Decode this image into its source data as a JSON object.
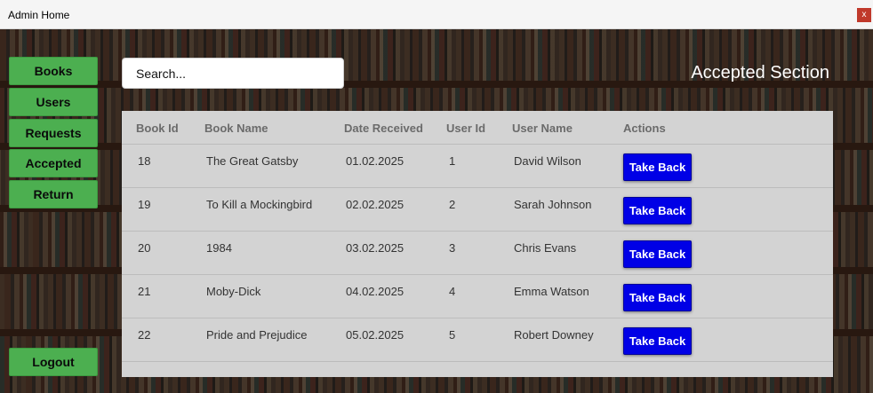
{
  "window": {
    "title": "Admin Home"
  },
  "sidebar": {
    "items": [
      {
        "label": "Books"
      },
      {
        "label": "Users"
      },
      {
        "label": "Requests"
      },
      {
        "label": "Accepted"
      },
      {
        "label": "Return"
      }
    ],
    "logout_label": "Logout"
  },
  "search": {
    "placeholder": "Search..."
  },
  "section_title": "Accepted Section",
  "table": {
    "columns": [
      "Book Id",
      "Book Name",
      "Date Received",
      "User Id",
      "User Name",
      "Actions"
    ],
    "rows": [
      {
        "book_id": "18",
        "book_name": "The Great Gatsby",
        "date_received": "01.02.2025",
        "user_id": "1",
        "user_name": "David Wilson",
        "action": "Take Back"
      },
      {
        "book_id": "19",
        "book_name": "To Kill a Mockingbird",
        "date_received": "02.02.2025",
        "user_id": "2",
        "user_name": "Sarah Johnson",
        "action": "Take Back"
      },
      {
        "book_id": "20",
        "book_name": "1984",
        "date_received": "03.02.2025",
        "user_id": "3",
        "user_name": "Chris Evans",
        "action": "Take Back"
      },
      {
        "book_id": "21",
        "book_name": "Moby-Dick",
        "date_received": "04.02.2025",
        "user_id": "4",
        "user_name": "Emma Watson",
        "action": "Take Back"
      },
      {
        "book_id": "22",
        "book_name": "Pride and Prejudice",
        "date_received": "05.02.2025",
        "user_id": "5",
        "user_name": "Robert Downey",
        "action": "Take Back"
      }
    ]
  },
  "colors": {
    "nav_button": "#4caf50",
    "action_button": "#0000e6",
    "table_background": "#d3d3d3"
  }
}
